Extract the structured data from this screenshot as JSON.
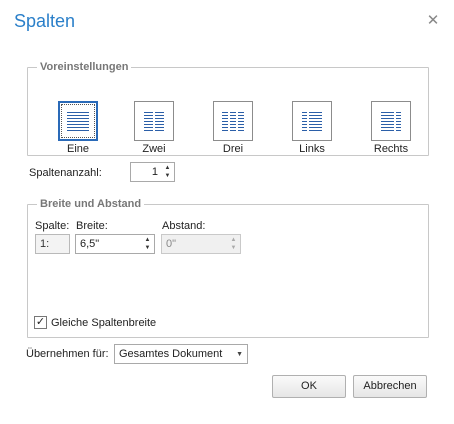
{
  "dialog": {
    "title": "Spalten",
    "close_icon": "close-icon"
  },
  "presets": {
    "legend": "Voreinstellungen",
    "items": [
      {
        "label": "Eine",
        "icon": "one-column-icon",
        "selected": true
      },
      {
        "label": "Zwei",
        "icon": "two-columns-icon",
        "selected": false
      },
      {
        "label": "Drei",
        "icon": "three-columns-icon",
        "selected": false
      },
      {
        "label": "Links",
        "icon": "left-column-icon",
        "selected": false
      },
      {
        "label": "Rechts",
        "icon": "right-column-icon",
        "selected": false
      }
    ]
  },
  "column_count": {
    "label": "Spaltenanzahl:",
    "value": "1"
  },
  "width_spacing": {
    "legend": "Breite und Abstand",
    "headers": {
      "column": "Spalte:",
      "width": "Breite:",
      "spacing": "Abstand:"
    },
    "row": {
      "column": "1:",
      "width": "6,5\"",
      "spacing": "0\""
    }
  },
  "equal_width": {
    "label": "Gleiche Spaltenbreite",
    "checked": true
  },
  "apply_to": {
    "label": "Übernehmen für:",
    "value": "Gesamtes Dokument"
  },
  "buttons": {
    "ok": "OK",
    "cancel": "Abbrechen"
  },
  "colors": {
    "accent": "#2a7fc9",
    "icon_blue": "#2b5fa8"
  }
}
